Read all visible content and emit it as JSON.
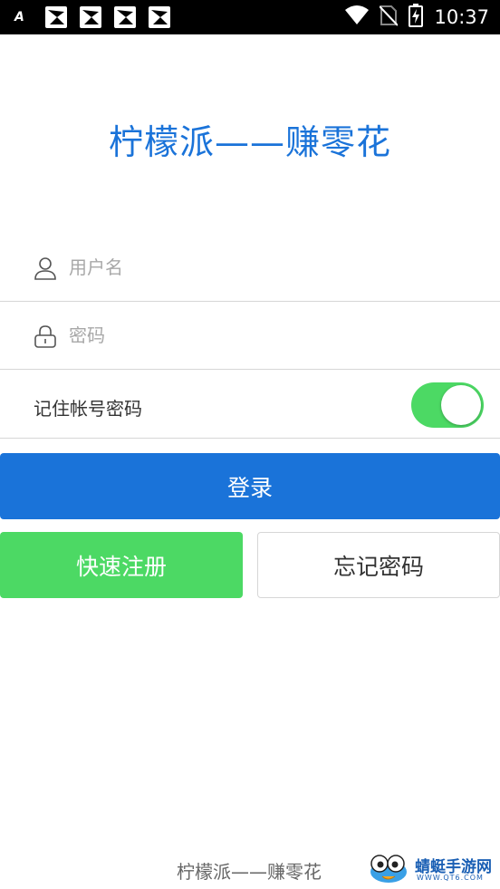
{
  "status_bar": {
    "time": "10:37",
    "left_icons": [
      "font-indicator-icon",
      "notification-app-icon",
      "notification-app-icon",
      "notification-app-icon",
      "notification-app-icon"
    ],
    "right_icons": [
      "wifi-icon",
      "no-sim-icon",
      "battery-charging-icon"
    ]
  },
  "app": {
    "title": "柠檬派——赚零花"
  },
  "login_form": {
    "username_placeholder": "用户名",
    "username_value": "",
    "password_placeholder": "密码",
    "password_value": "",
    "remember_label": "记住帐号密码",
    "remember_enabled": true,
    "login_button": "登录",
    "register_button": "快速注册",
    "forgot_button": "忘记密码"
  },
  "footer": {
    "text": "柠檬派——赚零花",
    "watermark_text": "蜻蜓手游网",
    "watermark_url": "WWW.QT6.COM"
  },
  "colors": {
    "primary": "#1a73d9",
    "success": "#4cd964",
    "status_bar": "#000000"
  }
}
